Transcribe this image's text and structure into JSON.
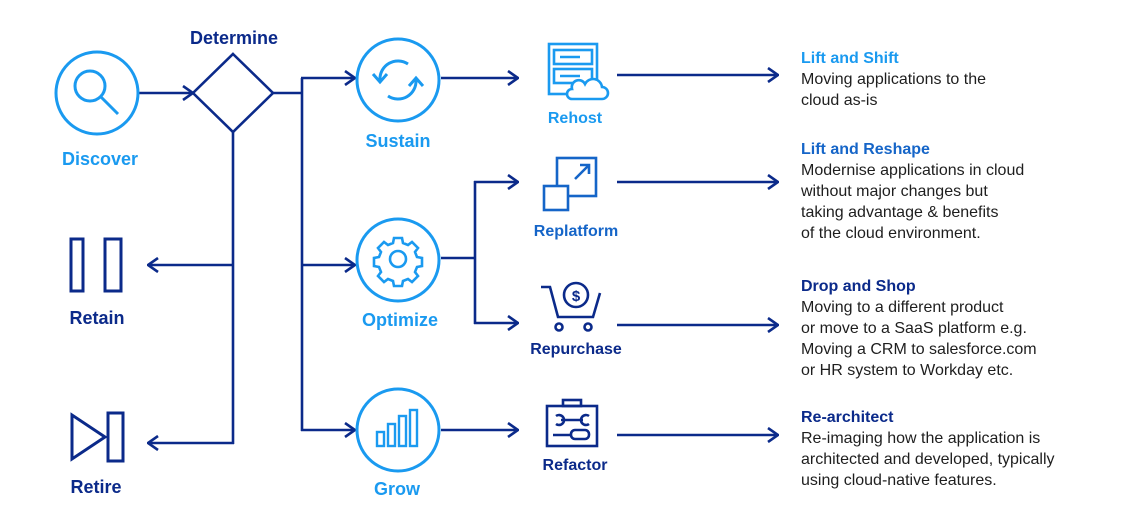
{
  "colors": {
    "light_blue": "#1a9af0",
    "mid_blue": "#1565c8",
    "navy": "#0b2a8a",
    "body_text": "#1e1e1e"
  },
  "nodes": {
    "discover": {
      "label": "Discover",
      "icon": "magnifier-icon"
    },
    "determine": {
      "label": "Determine",
      "icon": "decision-diamond"
    },
    "retain": {
      "label": "Retain",
      "icon": "pause-icon"
    },
    "retire": {
      "label": "Retire",
      "icon": "skip-end-icon"
    },
    "sustain": {
      "label": "Sustain",
      "icon": "refresh-icon"
    },
    "optimize": {
      "label": "Optimize",
      "icon": "gear-icon"
    },
    "grow": {
      "label": "Grow",
      "icon": "bar-chart-icon"
    },
    "rehost": {
      "label": "Rehost",
      "icon": "server-cloud-icon"
    },
    "replatform": {
      "label": "Replatform",
      "icon": "resize-icon"
    },
    "repurchase": {
      "label": "Repurchase",
      "icon": "cart-dollar-icon"
    },
    "refactor": {
      "label": "Refactor",
      "icon": "toolbox-icon"
    }
  },
  "descriptions": [
    {
      "title": "Lift and Shift",
      "lines": [
        "Moving applications to the",
        "cloud as-is"
      ]
    },
    {
      "title": "Lift and Reshape",
      "lines": [
        "Modernise applications in cloud",
        "without major changes but",
        "taking advantage & benefits",
        "of the cloud environment."
      ]
    },
    {
      "title": "Drop and Shop",
      "lines": [
        "Moving to a different product",
        "or move to a SaaS platform e.g.",
        "Moving a CRM to salesforce.com",
        "or HR system to Workday etc."
      ]
    },
    {
      "title": "Re-architect",
      "lines": [
        "Re-imaging how the application is",
        "architected and developed, typically",
        "using cloud-native features."
      ]
    }
  ]
}
